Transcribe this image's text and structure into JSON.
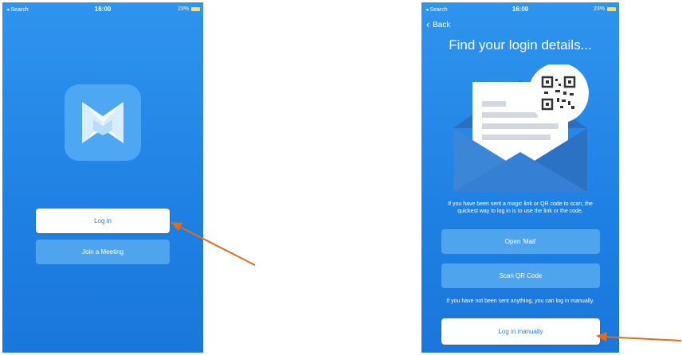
{
  "left_screen": {
    "status": {
      "carrier": "◂ Search",
      "time": "16:00",
      "battery_pct": "23%"
    },
    "buttons": {
      "login": "Log in",
      "join": "Join a Meeting"
    }
  },
  "right_screen": {
    "status": {
      "carrier": "◂ Search",
      "time": "16:00",
      "battery_pct": "23%"
    },
    "back_label": "Back",
    "title": "Find your login details...",
    "description": "If you have been sent a magic link or QR code to scan, the quickest way to log in is to use the link or the code.",
    "buttons": {
      "open_mail": "Open 'Mail'",
      "scan_qr": "Scan QR Code",
      "log_in_manually": "Log in manually"
    },
    "manual_note": "If you have not been sent anything, you can log in manually."
  },
  "colors": {
    "background_blue": "#1f80e3",
    "button_blue": "#4ea5ee",
    "button_text_blue": "#2f7fd4",
    "arrow": "#e26c1a"
  },
  "icons": [
    "app-logo-icon",
    "back-chevron-icon",
    "envelope-icon",
    "qr-code-icon",
    "battery-icon",
    "wifi-icon",
    "signal-icon"
  ]
}
